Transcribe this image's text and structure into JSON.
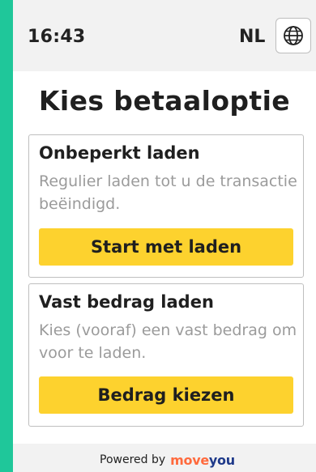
{
  "status": {
    "time": "16:43",
    "language": "NL",
    "language_icon": "globe-icon"
  },
  "page": {
    "title": "Kies betaaloptie"
  },
  "options": [
    {
      "heading": "Onbeperkt laden",
      "description": "Regulier laden tot u de transactie beëindigd.",
      "button_label": "Start met laden"
    },
    {
      "heading": "Vast bedrag laden",
      "description": "Kies (vooraf) een vast bedrag om voor te laden.",
      "button_label": "Bedrag kiezen"
    }
  ],
  "footer": {
    "powered_by": "Powered by",
    "brand_part1": "move",
    "brand_part2": "you"
  },
  "colors": {
    "accent_yellow": "#fdd22e",
    "side_green": "#1fc79a",
    "brand_orange": "#ff6a3d",
    "brand_navy": "#1f3a8a"
  }
}
